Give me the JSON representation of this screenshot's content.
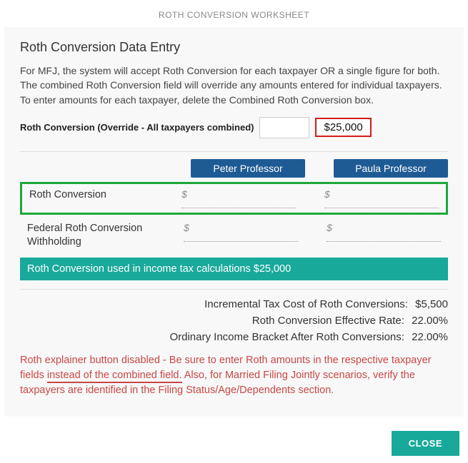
{
  "worksheet_title": "ROTH CONVERSION WORKSHEET",
  "section_heading": "Roth Conversion Data Entry",
  "intro_text": "For MFJ, the system will accept Roth Conversion for each taxpayer OR a single figure for both. The combined Roth Conversion field will override any amounts entered for individual taxpayers. To enter amounts for each taxpayer, delete the Combined Roth Conversion box.",
  "override": {
    "label": "Roth Conversion (Override - All taxpayers combined)",
    "input_value": "",
    "highlight_value": "$25,000"
  },
  "taxpayers": [
    "Peter Professor",
    "Paula Professor"
  ],
  "rows": {
    "roth_conversion": {
      "label": "Roth Conversion",
      "tp1": "$",
      "tp2": "$"
    },
    "fed_withholding": {
      "label": "Federal Roth Conversion Withholding",
      "tp1": "$",
      "tp2": "$"
    }
  },
  "teal_bar_text": "Roth Conversion used in income tax calculations $25,000",
  "summary": {
    "line1": {
      "label": "Incremental Tax Cost of Roth Conversions:",
      "value": "$5,500"
    },
    "line2": {
      "label": "Roth Conversion Effective Rate:",
      "value": "22.00%"
    },
    "line3": {
      "label": "Ordinary Income Bracket After Roth Conversions:",
      "value": "22.00%"
    }
  },
  "warning": {
    "part1": "Roth explainer button disabled - Be sure to enter Roth amounts in the respective taxpayer fields ",
    "underlined": "instead of the combined field.",
    "part2": " Also, for Married Filing Jointly scenarios, verify the taxpayers are identified in the Filing Status/Age/Dependents section."
  },
  "close_label": "CLOSE"
}
